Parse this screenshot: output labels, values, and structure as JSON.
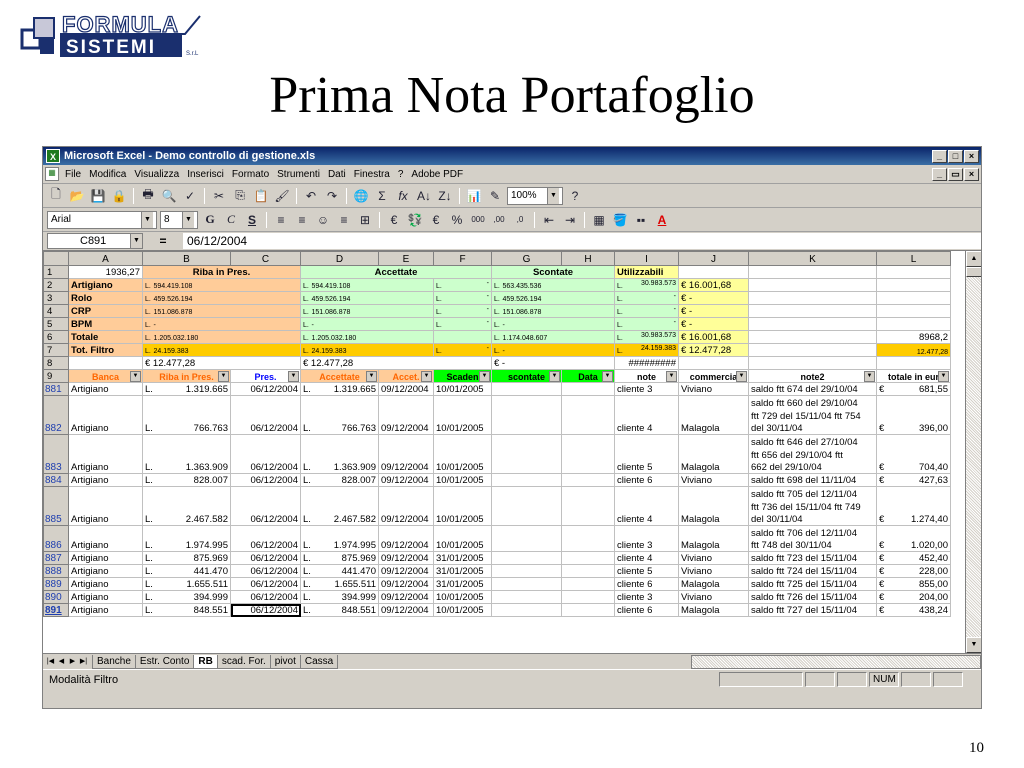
{
  "slide": {
    "logo_line1": "FORMULA",
    "logo_line2": "SISTEMI",
    "logo_srl": "S.r.L",
    "title": "Prima Nota Portafoglio",
    "page_number": "10"
  },
  "window": {
    "title": "Microsoft Excel - Demo controllo di gestione.xls",
    "menus": [
      "File",
      "Modifica",
      "Visualizza",
      "Inserisci",
      "Formato",
      "Strumenti",
      "Dati",
      "Finestra",
      "?",
      "Adobe PDF"
    ],
    "zoom": "100%",
    "font": "Arial",
    "font_size": "8",
    "name_box": "C891",
    "formula": "06/12/2004"
  },
  "columns": [
    "A",
    "B",
    "C",
    "D",
    "E",
    "F",
    "G",
    "H",
    "I",
    "J",
    "K",
    "L"
  ],
  "summary_rows": [
    {
      "row": "1",
      "a": "1936,27",
      "b": "Riba in Pres.",
      "d": "Accettate",
      "g": "Scontate",
      "i": "Utilizzabili"
    },
    {
      "row": "2",
      "a": "Artigiano",
      "b": "594.419.108",
      "d": "594.419.108",
      "e": "-",
      "g": "563.435.536",
      "i": "30.983.573",
      "j": "€ 16.001,68"
    },
    {
      "row": "3",
      "a": "Rolo",
      "b": "459.526.194",
      "d": "459.526.194",
      "e": "-",
      "g": "459.526.194",
      "i": "-",
      "j": "-"
    },
    {
      "row": "4",
      "a": "CRP",
      "b": "151.086.878",
      "d": "151.086.878",
      "e": "-",
      "g": "151.086.878",
      "i": "-",
      "j": "-"
    },
    {
      "row": "5",
      "a": "BPM",
      "b": "-",
      "d": "-",
      "e": "-",
      "g": "-",
      "i": "-",
      "j": "-"
    },
    {
      "row": "6",
      "a": "Totale",
      "b": "1.205.032.180",
      "d": "1.205.032.180",
      "g": "1.174.048.607",
      "i": "30.983.573",
      "j": "€ 16.001,68",
      "l": "8968,2"
    },
    {
      "row": "7",
      "a": "Tot. Filtro",
      "b": "24.159.383",
      "d": "24.159.383",
      "e": "-",
      "g": "-",
      "i": "24.159.383",
      "j": "€ 12.477,28",
      "l": "12.477,28"
    },
    {
      "row": "8",
      "b": "€      12.477,28",
      "d": "€ 12.477,28",
      "g": "€           -",
      "i": "#########"
    }
  ],
  "currency_prefix": "L.",
  "euro": "€",
  "filter_headers": {
    "row": "9",
    "a": "Banca",
    "b": "Riba in Pres.",
    "c": "Pres.",
    "d": "Accettate",
    "e": "Accet.",
    "f": "Scaden",
    "g": "scontate",
    "h": "Data",
    "i": "note",
    "j": "commercia",
    "k": "note2",
    "l": "totale in eur"
  },
  "data_rows": [
    {
      "row": "881",
      "banca": "Artigiano",
      "riba": "1.319.665",
      "pres": "06/12/2004",
      "acc": "1.319.665",
      "accd": "09/12/2004",
      "scad": "10/01/2005",
      "note": "cliente 3",
      "comm": "Viviano",
      "note2": [
        "saldo ftt 674 del 29/10/04"
      ],
      "tot": "681,55"
    },
    {
      "row": "882",
      "banca": "Artigiano",
      "riba": "766.763",
      "pres": "06/12/2004",
      "acc": "766.763",
      "accd": "09/12/2004",
      "scad": "10/01/2005",
      "note": "cliente 4",
      "comm": "Malagola",
      "note2": [
        "saldo ftt 660 del 29/10/04",
        "ftt 729 del 15/11/04 ftt 754",
        "del 30/11/04"
      ],
      "tot": "396,00"
    },
    {
      "row": "883",
      "banca": "Artigiano",
      "riba": "1.363.909",
      "pres": "06/12/2004",
      "acc": "1.363.909",
      "accd": "09/12/2004",
      "scad": "10/01/2005",
      "note": "cliente 5",
      "comm": "Malagola",
      "note2": [
        "saldo ftt 646 del 27/10/04",
        "ftt 656 del 29/10/04  ftt",
        "662 del 29/10/04"
      ],
      "tot": "704,40"
    },
    {
      "row": "884",
      "banca": "Artigiano",
      "riba": "828.007",
      "pres": "06/12/2004",
      "acc": "828.007",
      "accd": "09/12/2004",
      "scad": "10/01/2005",
      "note": "cliente 6",
      "comm": "Viviano",
      "note2": [
        "saldo ftt 698 del 11/11/04"
      ],
      "tot": "427,63"
    },
    {
      "row": "885",
      "banca": "Artigiano",
      "riba": "2.467.582",
      "pres": "06/12/2004",
      "acc": "2.467.582",
      "accd": "09/12/2004",
      "scad": "10/01/2005",
      "note": "cliente 4",
      "comm": "Malagola",
      "note2": [
        "saldo ftt 705 del 12/11/04",
        "ftt 736 del 15/11/04 ftt 749",
        "del 30/11/04"
      ],
      "tot": "1.274,40"
    },
    {
      "row": "886",
      "banca": "Artigiano",
      "riba": "1.974.995",
      "pres": "06/12/2004",
      "acc": "1.974.995",
      "accd": "09/12/2004",
      "scad": "10/01/2005",
      "note": "cliente 3",
      "comm": "Malagola",
      "note2": [
        "saldo ftt 706 del 12/11/04",
        "ftt 748 del 30/11/04"
      ],
      "tot": "1.020,00"
    },
    {
      "row": "887",
      "banca": "Artigiano",
      "riba": "875.969",
      "pres": "06/12/2004",
      "acc": "875.969",
      "accd": "09/12/2004",
      "scad": "31/01/2005",
      "note": "cliente 4",
      "comm": "Viviano",
      "note2": [
        "saldo ftt 723 del 15/11/04"
      ],
      "tot": "452,40"
    },
    {
      "row": "888",
      "banca": "Artigiano",
      "riba": "441.470",
      "pres": "06/12/2004",
      "acc": "441.470",
      "accd": "09/12/2004",
      "scad": "31/01/2005",
      "note": "cliente 5",
      "comm": "Viviano",
      "note2": [
        "saldo ftt 724 del 15/11/04"
      ],
      "tot": "228,00"
    },
    {
      "row": "889",
      "banca": "Artigiano",
      "riba": "1.655.511",
      "pres": "06/12/2004",
      "acc": "1.655.511",
      "accd": "09/12/2004",
      "scad": "31/01/2005",
      "note": "cliente 6",
      "comm": "Malagola",
      "note2": [
        "saldo ftt 725 del 15/11/04"
      ],
      "tot": "855,00"
    },
    {
      "row": "890",
      "banca": "Artigiano",
      "riba": "394.999",
      "pres": "06/12/2004",
      "acc": "394.999",
      "accd": "09/12/2004",
      "scad": "10/01/2005",
      "note": "cliente 3",
      "comm": "Viviano",
      "note2": [
        "saldo ftt 726 del 15/11/04"
      ],
      "tot": "204,00"
    },
    {
      "row": "891",
      "banca": "Artigiano",
      "riba": "848.551",
      "pres": "06/12/2004",
      "acc": "848.551",
      "accd": "09/12/2004",
      "scad": "10/01/2005",
      "note": "cliente 6",
      "comm": "Malagola",
      "note2": [
        "saldo ftt 727 del 15/11/04"
      ],
      "tot": "438,24",
      "active": true
    }
  ],
  "sheet_tabs": [
    "Banche",
    "Estr. Conto",
    "RB",
    "scad. For.",
    "pivot",
    "Cassa"
  ],
  "active_tab": "RB",
  "status": {
    "mode": "Modalità Filtro",
    "num": "NUM"
  }
}
